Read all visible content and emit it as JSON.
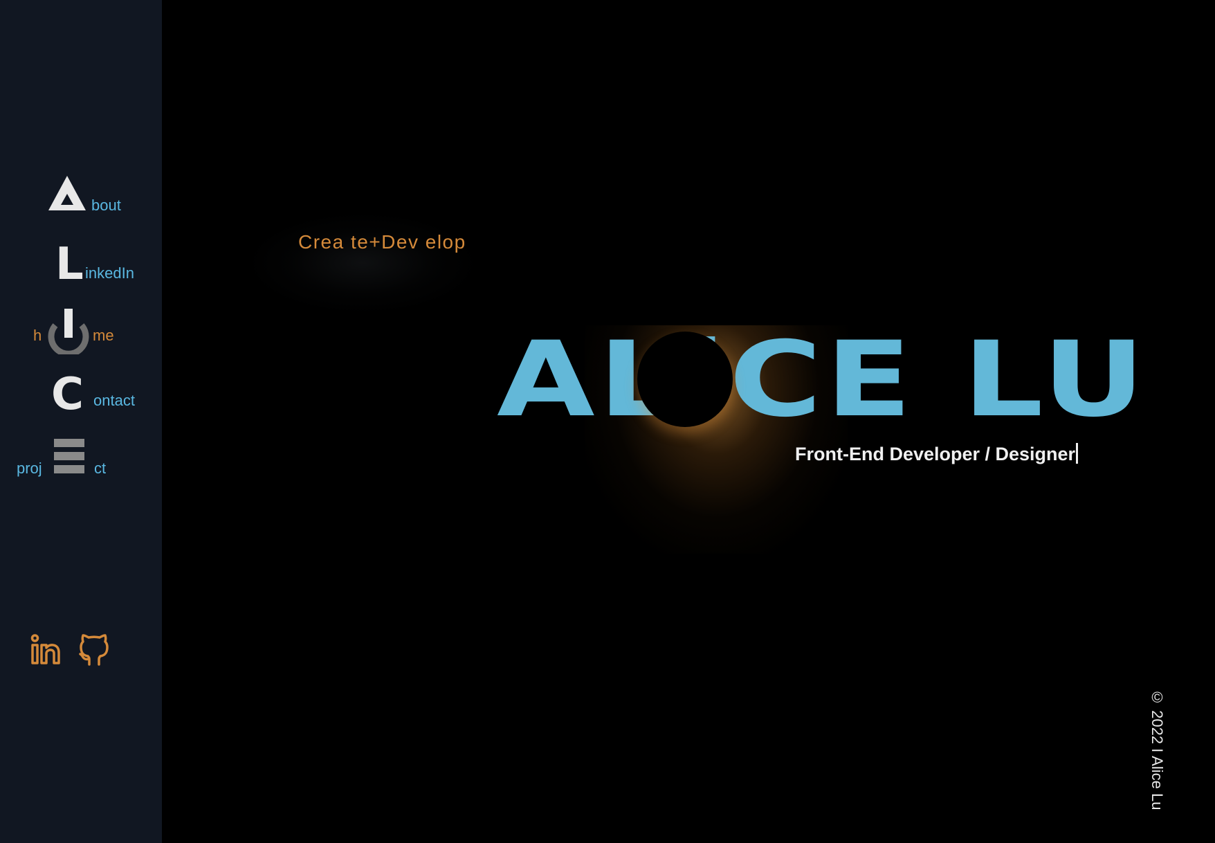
{
  "sidebar": {
    "nav": [
      {
        "key": "about",
        "glyph_icon": "triangle-a-icon",
        "text": "bout"
      },
      {
        "key": "linkedin",
        "glyph": "L",
        "text": "inkedIn"
      },
      {
        "key": "home",
        "glyph_icon": "power-icon",
        "prefix": "h",
        "text": "me"
      },
      {
        "key": "contact",
        "glyph": "C",
        "text": "ontact"
      },
      {
        "key": "projects",
        "glyph_icon": "hamburger-icon",
        "prefix": "proj",
        "text": "ct"
      }
    ],
    "social": [
      {
        "icon": "linkedin-icon"
      },
      {
        "icon": "github-icon"
      }
    ]
  },
  "main": {
    "tagline": "Crea te+Dev elop",
    "name": "ALiCE LU",
    "subtitle": "Front-End Developer / Designer",
    "copyright": "© 2022 I Alice Lu"
  },
  "colors": {
    "sidebar_bg": "#111722",
    "main_bg": "#000000",
    "accent_blue": "#5ab8e2",
    "accent_orange": "#d58a3a",
    "name_blue": "#63b8d8",
    "glyph_white": "#e8e8e8"
  }
}
